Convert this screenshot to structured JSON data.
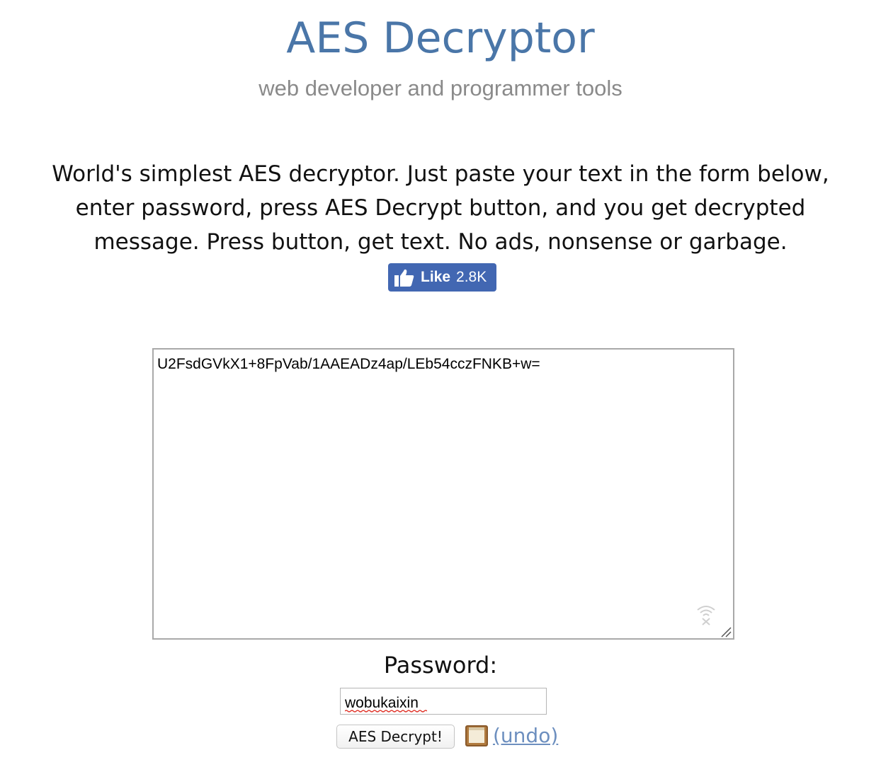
{
  "header": {
    "title": "AES Decryptor",
    "subtitle": "web developer and programmer tools"
  },
  "description": "World's simplest AES decryptor. Just paste your text in the form below, enter password, press AES Decrypt button, and you get decrypted message. Press button, get text. No ads, nonsense or garbage.",
  "like_button": {
    "icon": "thumbs-up-icon",
    "label": "Like",
    "count": "2.8K",
    "color": "#4267b2"
  },
  "input": {
    "value": "U2FsdGVkX1+8FpVab/1AAEADz4ap/LEb54cczFNKB+w="
  },
  "password": {
    "label": "Password:",
    "value": "wobukaixin"
  },
  "actions": {
    "decrypt_label": "AES Decrypt!",
    "save_icon": "floppy-disk-icon",
    "undo_label": "(undo)"
  },
  "colors": {
    "title": "#4a76a8",
    "subtitle": "#8a8a8a",
    "link": "#6d8fbf"
  }
}
